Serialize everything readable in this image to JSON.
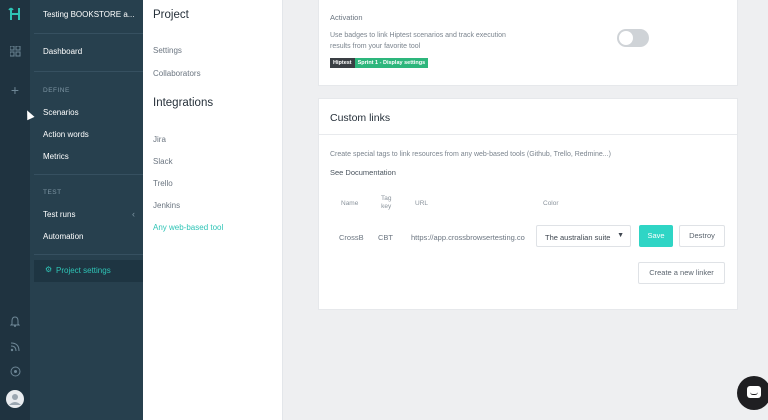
{
  "icon_bar": {
    "logo_icon": "hiptest-logo-icon",
    "top_icons": [
      "grid-icon",
      "plus-icon"
    ],
    "bottom_icons": [
      "bell-icon",
      "rss-icon",
      "help-icon",
      "user-avatar"
    ]
  },
  "nav": {
    "project_title": "Testing BOOKSTORE a...",
    "dashboard": "Dashboard",
    "define_section": "DEFINE",
    "scenarios": "Scenarios",
    "action_words": "Action words",
    "metrics": "Metrics",
    "test_section": "TEST",
    "test_runs": "Test runs",
    "automation": "Automation",
    "project_settings": "Project settings"
  },
  "subnav": {
    "project_heading": "Project",
    "settings": "Settings",
    "collaborators": "Collaborators",
    "integrations_heading": "Integrations",
    "jira": "Jira",
    "slack": "Slack",
    "trello": "Trello",
    "jenkins": "Jenkins",
    "any_web_tool": "Any web-based tool"
  },
  "activation": {
    "title": "Activation",
    "description": "Use badges to link Hiptest scenarios and track execution results from your favorite tool",
    "badge_left": "Hiptest",
    "badge_right": "Sprint 1 - Display settings",
    "toggle_on": false
  },
  "custom_links": {
    "title": "Custom links",
    "description": "Create special tags to link resources from any web-based tools (Github, Trello, Redmine...)",
    "see_documentation": "See Documentation",
    "columns": {
      "name": "Name",
      "tag_key_line1": "Tag",
      "tag_key_line2": "key",
      "url": "URL",
      "color": "Color"
    },
    "row": {
      "name": "CrossB",
      "tag_key": "CBT",
      "url": "https://app.crossbrowsertesting.com",
      "color": "The australian suite"
    },
    "save_label": "Save",
    "destroy_label": "Destroy",
    "create_label": "Create a new linker"
  },
  "colors": {
    "accent": "#2ec4b6",
    "sidebar_dark": "#1f3340",
    "sidebar": "#27404e",
    "badge_green": "#2db67c"
  }
}
